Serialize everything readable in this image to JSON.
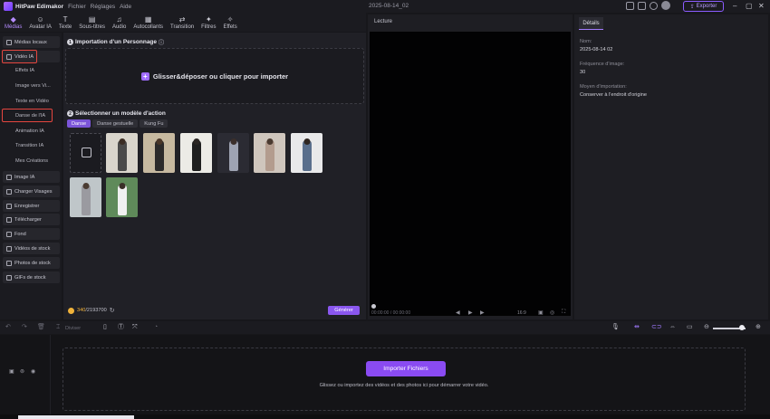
{
  "titlebar": {
    "app_title": "HitPaw Edimakor",
    "menus": [
      "Fichier",
      "Réglages",
      "Aide"
    ],
    "center_title": "2025-08-14_02",
    "export_label": "Exporter"
  },
  "toolbar": {
    "tools": [
      {
        "label": "Médias",
        "icon": "media-icon",
        "glyph": "◆",
        "active": true
      },
      {
        "label": "Avatar IA",
        "icon": "avatar-icon",
        "glyph": "☺",
        "active": false
      },
      {
        "label": "Texte",
        "icon": "text-icon",
        "glyph": "T",
        "active": false
      },
      {
        "label": "Sous-titres",
        "icon": "subtitles-icon",
        "glyph": "▤",
        "active": false
      },
      {
        "label": "Audio",
        "icon": "audio-icon",
        "glyph": "♫",
        "active": false
      },
      {
        "label": "Autocollants",
        "icon": "stickers-icon",
        "glyph": "▦",
        "active": false
      },
      {
        "label": "Transition",
        "icon": "transition-icon",
        "glyph": "⇄",
        "active": false
      },
      {
        "label": "Filtres",
        "icon": "filters-icon",
        "glyph": "✦",
        "active": false
      },
      {
        "label": "Effets",
        "icon": "effects-icon",
        "glyph": "✧",
        "active": false
      }
    ]
  },
  "sidebar": {
    "media_local": "Médias locaux",
    "video_ia": "Vidéo IA",
    "sub_items": [
      "Effets IA",
      "Image vers Vi...",
      "Texte en Vidéo",
      "Danse de l'IA",
      "Animation IA",
      "Transition IA",
      "Mes Créations"
    ],
    "items": [
      "Image IA",
      "Charger Visages",
      "Enregistrer",
      "Télécharger",
      "Fond",
      "Vidéos de stock",
      "Photos de stock",
      "GIFs de stock"
    ]
  },
  "character_section": {
    "number": "1",
    "title": "Importation d'un Personnage",
    "info_icon": "info-icon",
    "drop_text": "Glisser&déposer ou cliquer pour importer"
  },
  "model_section": {
    "number": "2",
    "title": "Sélectionner un modèle d'action",
    "tabs": [
      "Danse",
      "Danse gestuelle",
      "Kung Fu"
    ],
    "active_tab": "Danse"
  },
  "credits": {
    "used": "340",
    "total": "/2193700"
  },
  "generate_label": "Générer",
  "preview": {
    "label": "Lecture",
    "time": "00:00:00 / 00:00:00",
    "ratio": "16:9"
  },
  "properties": {
    "tab": "Détails",
    "fields": [
      {
        "label": "Nom:",
        "value": "2025-08-14 02"
      },
      {
        "label": "Fréquence d'image:",
        "value": "30"
      },
      {
        "label": "Moyen d'importation:",
        "value": "Conserver à l'endroit d'origine"
      }
    ]
  },
  "timeline_toolbar": {
    "split_label": "Diviser"
  },
  "timeline": {
    "import_label": "Importer Fichiers",
    "hint": "Glissez ou importez des vidéos et des photos ici pour démarrer votre vidéo."
  },
  "thumbnails": [
    {
      "bg": "#d9d5cc",
      "fig": "#4a4a4a",
      "head": "#3b2d24"
    },
    {
      "bg": "#c7b9a0",
      "fig": "#2c2a2a",
      "head": "#4a3628"
    },
    {
      "bg": "#ecebe6",
      "fig": "#1e1e1e",
      "head": "#2a2522"
    },
    {
      "bg": "#2b2b33",
      "fig": "#9ea3b2",
      "head": "#3b2f2b"
    },
    {
      "bg": "#cfc6bd",
      "fig": "#b39c8e",
      "head": "#4a3a30"
    },
    {
      "bg": "#e9e9ea",
      "fig": "#5a6f8c",
      "head": "#2f2621"
    },
    {
      "bg": "#bfc6c9",
      "fig": "#9a9aa0",
      "head": "#4b3c32"
    },
    {
      "bg": "#5f8a5a",
      "fig": "#f0f0f0",
      "head": "#3a2f28"
    }
  ],
  "colors": {
    "accent": "#8a57ef",
    "highlight": "#e5463f"
  }
}
